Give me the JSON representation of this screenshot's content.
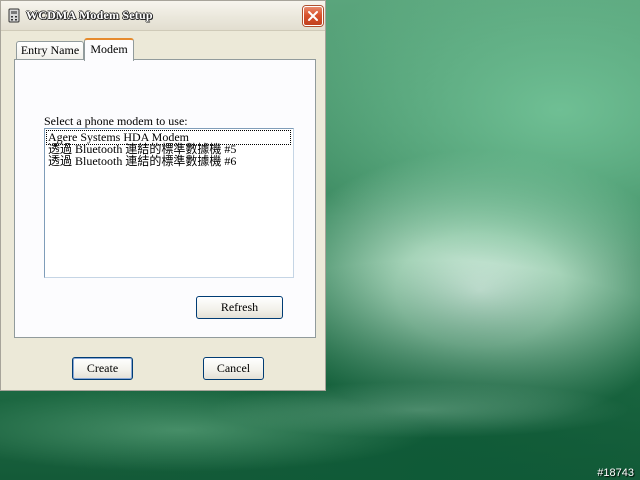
{
  "desktop": {
    "badge": "#18743"
  },
  "window": {
    "title": "WCDMA Modem Setup",
    "close_icon": "close-icon",
    "app_icon": "phone-icon"
  },
  "tabs": [
    {
      "label": "Entry Name",
      "active": false
    },
    {
      "label": "Modem",
      "active": true
    }
  ],
  "modem_panel": {
    "prompt": "Select a phone modem to use:",
    "modems": [
      "Agere Systems HDA Modem",
      "透過 Bluetooth 連結的標準數據機 #5",
      "透過 Bluetooth 連結的標準數據機 #6"
    ],
    "selected_index": 0,
    "refresh_label": "Refresh"
  },
  "buttons": {
    "create_label": "Create",
    "cancel_label": "Cancel"
  }
}
